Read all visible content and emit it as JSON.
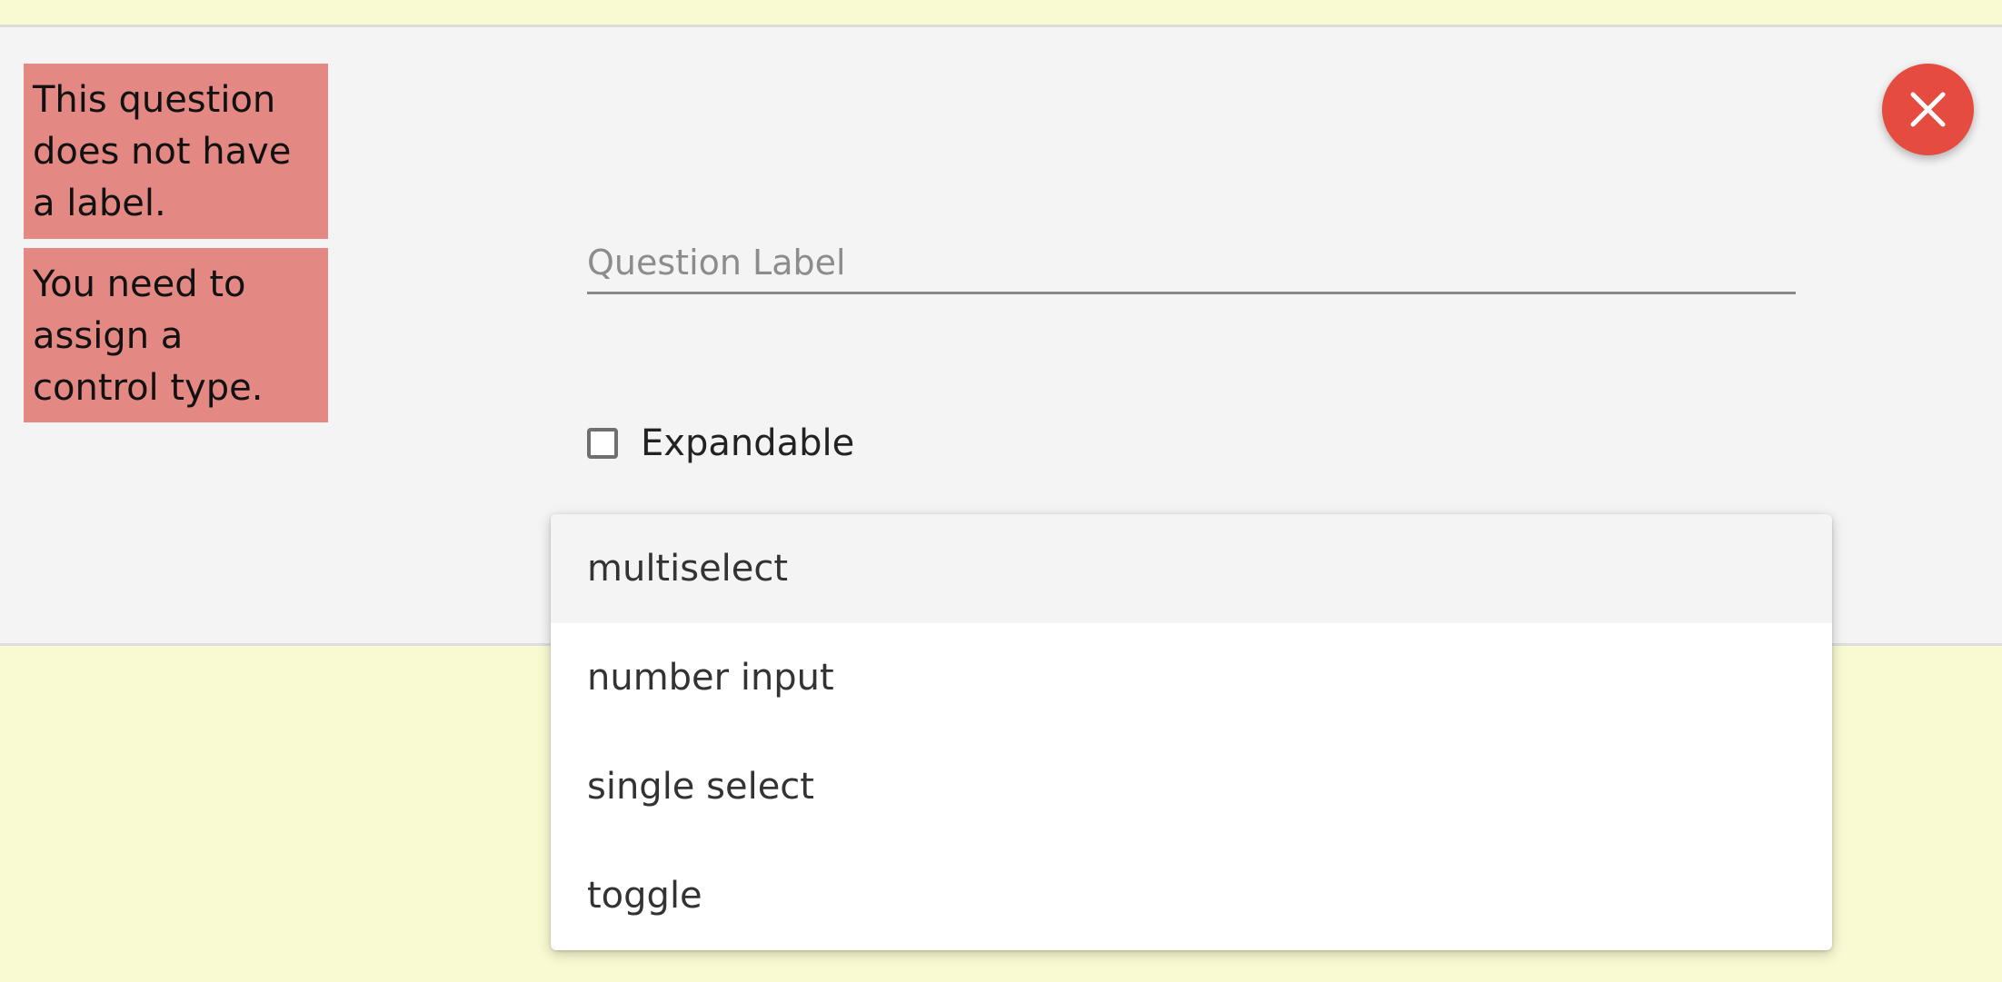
{
  "colors": {
    "page_background": "#fafad2",
    "card_background": "#f4f4f4",
    "error_background": "#e38883",
    "close_button": "#e54b3e",
    "dropdown_highlight": "#f4f4f4"
  },
  "errors": [
    "This question does not have a label.",
    "You need to assign a control type."
  ],
  "close_button": {
    "icon": "close-icon"
  },
  "question_label": {
    "value": "",
    "placeholder": "Question Label"
  },
  "expandable": {
    "label": "Expandable",
    "checked": false
  },
  "control_type_dropdown": {
    "options": [
      {
        "label": "multiselect",
        "highlighted": true
      },
      {
        "label": "number input",
        "highlighted": false
      },
      {
        "label": "single select",
        "highlighted": false
      },
      {
        "label": "toggle",
        "highlighted": false
      }
    ]
  }
}
